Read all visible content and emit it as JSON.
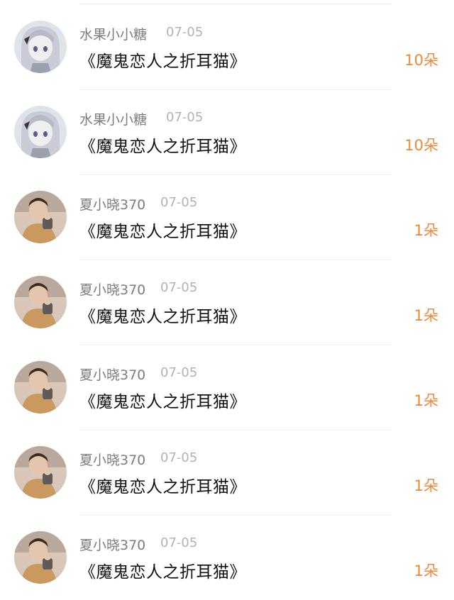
{
  "list": {
    "items": [
      {
        "user": "水果小小糖",
        "date": "07-05",
        "gift": "《魔鬼恋人之折耳猫》",
        "count": "10朵",
        "avatar": "anime-girl-avatar"
      },
      {
        "user": "水果小小糖",
        "date": "07-05",
        "gift": "《魔鬼恋人之折耳猫》",
        "count": "10朵",
        "avatar": "anime-girl-avatar"
      },
      {
        "user": "夏小晓370",
        "date": "07-05",
        "gift": "《魔鬼恋人之折耳猫》",
        "count": "1朵",
        "avatar": "boy-photo-avatar"
      },
      {
        "user": "夏小晓370",
        "date": "07-05",
        "gift": "《魔鬼恋人之折耳猫》",
        "count": "1朵",
        "avatar": "boy-photo-avatar"
      },
      {
        "user": "夏小晓370",
        "date": "07-05",
        "gift": "《魔鬼恋人之折耳猫》",
        "count": "1朵",
        "avatar": "boy-photo-avatar"
      },
      {
        "user": "夏小晓370",
        "date": "07-05",
        "gift": "《魔鬼恋人之折耳猫》",
        "count": "1朵",
        "avatar": "boy-photo-avatar"
      },
      {
        "user": "夏小晓370",
        "date": "07-05",
        "gift": "《魔鬼恋人之折耳猫》",
        "count": "1朵",
        "avatar": "boy-photo-avatar"
      }
    ]
  },
  "colors": {
    "count_accent": "#ee8a33",
    "username": "#7c7c7c",
    "date": "#b3b3b3",
    "gift_text": "#111111"
  }
}
